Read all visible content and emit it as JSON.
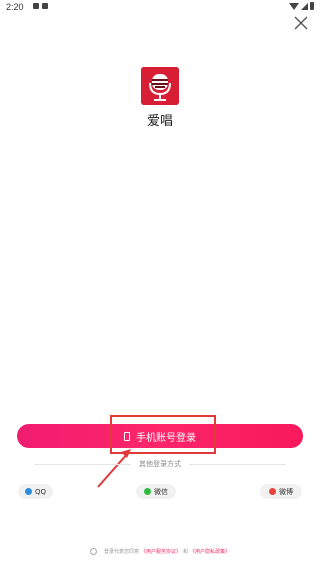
{
  "status_bar": {
    "time": "2:20"
  },
  "icons": {
    "close": "close-icon",
    "logo": "microphone-logo-icon",
    "phone": "phone-icon",
    "qq": "qq-icon",
    "wechat": "wechat-icon",
    "weibo": "weibo-icon"
  },
  "app": {
    "name": "爱唱"
  },
  "login": {
    "phone_label": "手机账号登录",
    "other_methods_label": "其他登录方式",
    "qq_label": "QQ",
    "wechat_label": "微信",
    "weibo_label": "微博"
  },
  "agreement": {
    "prefix": "登录代表您同意",
    "user_agreement": "《用户服务协议》",
    "and": "和",
    "privacy_policy": "《用户隐私政策》"
  },
  "colors": {
    "accent": "#fe2569",
    "logo_red": "#d81e34",
    "annotation": "#e23a3a"
  }
}
